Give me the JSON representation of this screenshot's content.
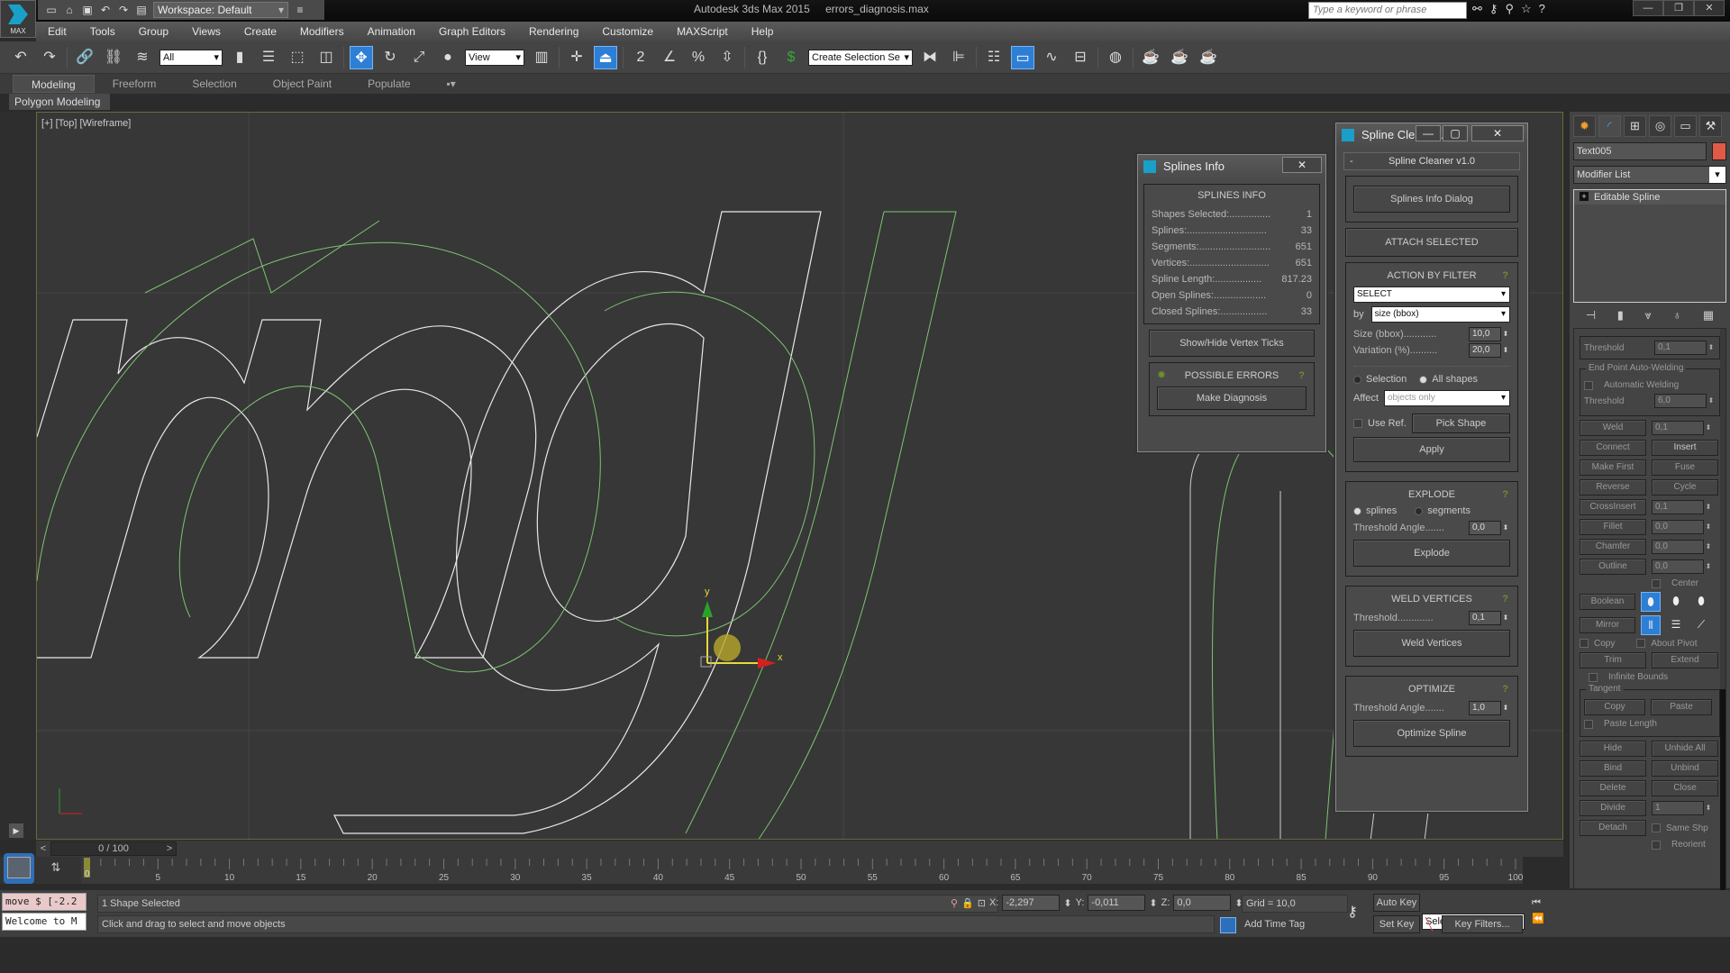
{
  "app": {
    "logo_label": "MAX",
    "workspace": "Workspace: Default",
    "title": "Autodesk 3ds Max  2015",
    "file": "errors_diagnosis.max",
    "search_placeholder": "Type a keyword or phrase"
  },
  "menu": [
    "Edit",
    "Tools",
    "Group",
    "Views",
    "Create",
    "Modifiers",
    "Animation",
    "Graph Editors",
    "Rendering",
    "Customize",
    "MAXScript",
    "Help"
  ],
  "toolbar": {
    "filter_value": "All",
    "refcoord_value": "View",
    "selection_set_placeholder": "Create Selection Se",
    "snap_label": "2",
    "percent_label": "%"
  },
  "ribbon": {
    "tabs": [
      "Modeling",
      "Freeform",
      "Selection",
      "Object Paint",
      "Populate"
    ],
    "active": "Modeling",
    "sub_label": "Polygon Modeling"
  },
  "viewport": {
    "label": "[+] [Top] [Wireframe]",
    "gizmo_x": "x",
    "gizmo_y": "y"
  },
  "splines_info": {
    "title": "Splines Info",
    "heading": "SPLINES INFO",
    "rows": [
      {
        "label": "Shapes Selected:...............",
        "value": "1"
      },
      {
        "label": "Splines:.............................",
        "value": "33"
      },
      {
        "label": "Segments:..........................",
        "value": "651"
      },
      {
        "label": "Vertices:.............................",
        "value": "651"
      },
      {
        "label": "Spline Length:.................",
        "value": "817.23"
      },
      {
        "label": "Open Splines:...................",
        "value": "0"
      },
      {
        "label": "Closed Splines:.................",
        "value": "33"
      }
    ],
    "vertex_ticks_button": "Show/Hide Vertex Ticks",
    "errors_heading": "POSSIBLE ERRORS",
    "diagnosis_button": "Make Diagnosis",
    "help": "?"
  },
  "spline_cleaner": {
    "title": "Spline Cleane...",
    "rollout_title": "Spline Cleaner v1.0",
    "collapse": "-",
    "info_button": "Splines Info Dialog",
    "attach_button": "ATTACH SELECTED",
    "action_by_filter": {
      "heading": "ACTION BY FILTER",
      "action_value": "SELECT",
      "by_label": "by",
      "by_value": "size (bbox)",
      "size_label": "Size (bbox)............",
      "size_value": "10,0",
      "variation_label": "Variation (%)..........",
      "variation_value": "20,0",
      "radio_selection": "Selection",
      "radio_all": "All shapes",
      "radio_selected": "All shapes",
      "affect_label": "Affect",
      "affect_value": "objects only",
      "use_ref_label": "Use Ref.",
      "pick_shape_button": "Pick Shape",
      "apply_button": "Apply"
    },
    "explode": {
      "heading": "EXPLODE",
      "radio_splines": "splines",
      "radio_segments": "segments",
      "radio_selected": "splines",
      "threshold_label": "Threshold Angle.......",
      "threshold_value": "0,0",
      "button": "Explode"
    },
    "weld": {
      "heading": "WELD VERTICES",
      "threshold_label": "Threshold.............",
      "threshold_value": "0,1",
      "button": "Weld Vertices"
    },
    "optimize": {
      "heading": "OPTIMIZE",
      "threshold_label": "Threshold Angle.......",
      "threshold_value": "1,0",
      "button": "Optimize Spline"
    },
    "help": "?"
  },
  "command_panel": {
    "object_name": "Text005",
    "object_color": "#e05a47",
    "modifier_list": "Modifier List",
    "stack": [
      "Editable Spline"
    ],
    "rollout": {
      "threshold_label": "Threshold",
      "threshold_value": "0,1",
      "autoweld_group": "End Point Auto-Welding",
      "automatic_welding": "Automatic Welding",
      "autoweld_threshold_label": "Threshold",
      "autoweld_threshold_value": "6,0",
      "weld": "Weld",
      "weld_value": "0,1",
      "connect": "Connect",
      "insert": "Insert",
      "make_first": "Make First",
      "fuse": "Fuse",
      "reverse": "Reverse",
      "cycle": "Cycle",
      "crossinsert": "CrossInsert",
      "crossinsert_value": "0,1",
      "fillet": "Fillet",
      "fillet_value": "0,0",
      "chamfer": "Chamfer",
      "chamfer_value": "0,0",
      "outline": "Outline",
      "outline_value": "0,0",
      "center": "Center",
      "boolean": "Boolean",
      "mirror": "Mirror",
      "copy": "Copy",
      "about_pivot": "About Pivot",
      "trim": "Trim",
      "extend": "Extend",
      "infinite_bounds": "Infinite Bounds",
      "tangent_group": "Tangent",
      "tangent_copy": "Copy",
      "tangent_paste": "Paste",
      "paste_length": "Paste Length",
      "hide": "Hide",
      "unhide_all": "Unhide All",
      "bind": "Bind",
      "unbind": "Unbind",
      "delete": "Delete",
      "close": "Close",
      "divide": "Divide",
      "divide_value": "1",
      "detach": "Detach",
      "same_shp": "Same Shp",
      "reorient": "Reorient"
    }
  },
  "timeline": {
    "frame_display": "0 / 100",
    "current_frame": "0",
    "ticks": [
      "5",
      "10",
      "15",
      "20",
      "25",
      "30",
      "35",
      "40",
      "45",
      "50",
      "55",
      "60",
      "65",
      "70",
      "75",
      "80",
      "85",
      "90",
      "95",
      "100"
    ]
  },
  "status": {
    "maxscript_line1": "move $ [-2.2",
    "maxscript_line2": "Welcome to M",
    "selection": "1 Shape Selected",
    "prompt": "Click and drag to select and move objects",
    "x_label": "X:",
    "x": "-2,297",
    "y_label": "Y:",
    "y": "-0,011",
    "z_label": "Z:",
    "z": "0,0",
    "grid": "Grid = 10,0",
    "add_time_tag": "Add Time Tag",
    "auto_key": "Auto Key",
    "set_key": "Set Key",
    "key_mode": "Selected",
    "key_filters": "Key Filters..."
  }
}
